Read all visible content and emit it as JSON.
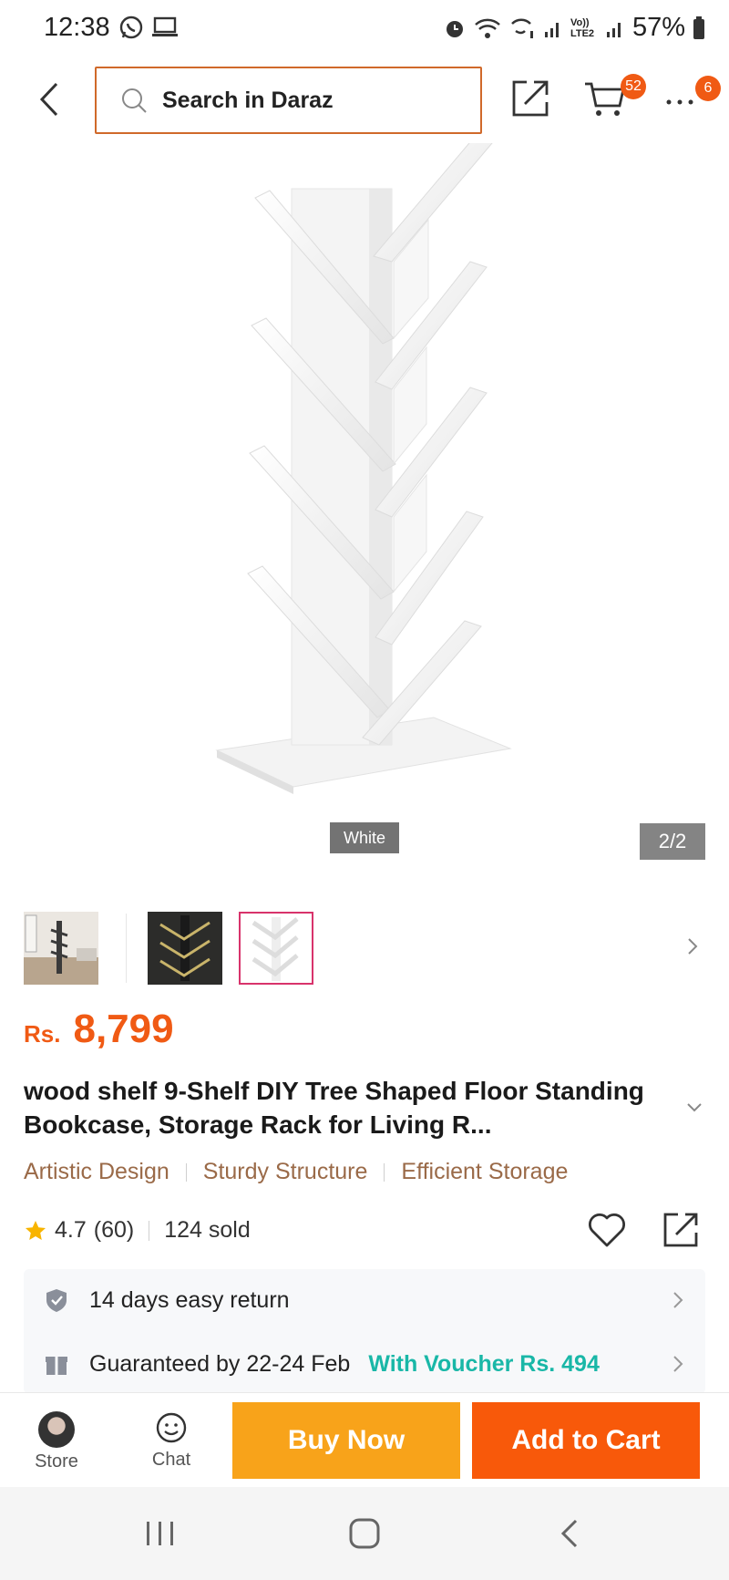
{
  "status_bar": {
    "time": "12:38",
    "battery": "57%",
    "network_label": "Vo)) LTE2",
    "icons": [
      "whatsapp-icon",
      "laptop-icon",
      "alarm-icon",
      "wifi-icon",
      "wifi-calling-icon",
      "signal-icon",
      "signal-icon",
      "battery-icon"
    ]
  },
  "top_nav": {
    "search_placeholder": "Search in Daraz",
    "cart_count": "52",
    "more_badge": "6",
    "accent": "#f05a14"
  },
  "gallery": {
    "variant_label": "White",
    "counter": "2/2",
    "thumbnails": [
      "thumb-room-scene",
      "thumb-black-shelf",
      "thumb-white-shelf"
    ],
    "active_thumbnail": 3
  },
  "product": {
    "currency": "Rs.",
    "price": "8,799",
    "title": "wood shelf 9-Shelf DIY Tree Shaped Floor Standing Bookcase, Storage Rack for Living R...",
    "highlights": [
      "Artistic Design",
      "Sturdy Structure",
      "Efficient Storage"
    ],
    "rating": "4.7",
    "rating_count": "(60)",
    "sold": "124 sold"
  },
  "info": {
    "return_text": "14 days easy return",
    "delivery_text": "Guaranteed by 22-24 Feb",
    "voucher_text": "With Voucher Rs. 494"
  },
  "action_bar": {
    "store_label": "Store",
    "chat_label": "Chat",
    "buy_now_label": "Buy Now",
    "add_to_cart_label": "Add to Cart",
    "buy_color": "#f8a31a",
    "cart_color": "#f8590a"
  }
}
